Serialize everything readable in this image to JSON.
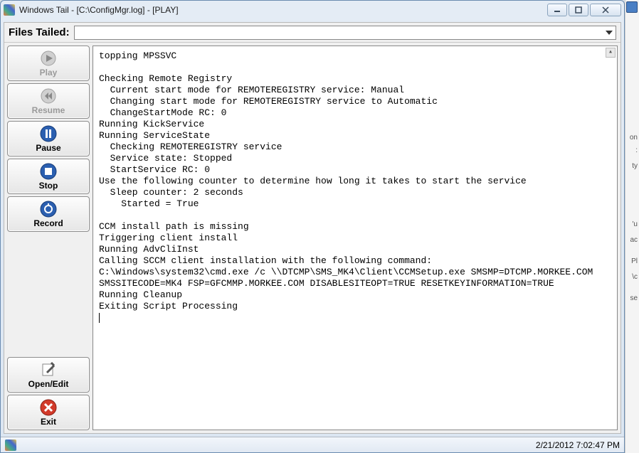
{
  "window": {
    "title": "Windows Tail - [C:\\ConfigMgr.log] - [PLAY]"
  },
  "files_tailed_label": "Files Tailed:",
  "buttons": {
    "play": "Play",
    "resume": "Resume",
    "pause": "Pause",
    "stop": "Stop",
    "record": "Record",
    "openedit": "Open/Edit",
    "exit": "Exit"
  },
  "log_text": "topping MPSSVC\n\nChecking Remote Registry\n  Current start mode for REMOTEREGISTRY service: Manual\n  Changing start mode for REMOTEREGISTRY service to Automatic\n  ChangeStartMode RC: 0\nRunning KickService\nRunning ServiceState\n  Checking REMOTEREGISTRY service\n  Service state: Stopped\n  StartService RC: 0\nUse the following counter to determine how long it takes to start the service\n  Sleep counter: 2 seconds\n    Started = True\n\nCCM install path is missing\nTriggering client install\nRunning AdvCliInst\nCalling SCCM client installation with the following command:\nC:\\Windows\\system32\\cmd.exe /c \\\\DTCMP\\SMS_MK4\\Client\\CCMSetup.exe SMSMP=DTCMP.MORKEE.COM\nSMSSITECODE=MK4 FSP=GFCMMP.MORKEE.COM DISABLESITEOPT=TRUE RESETKEYINFORMATION=TRUE\nRunning Cleanup\nExiting Script Processing",
  "status": {
    "datetime": "2/21/2012 7:02:47 PM"
  },
  "rightstrip": {
    "t1": "on",
    "t2": ":",
    "t3": "ty",
    "t4": "'u",
    "t5": "ac",
    "t6": "Pl",
    "t7": "\\c",
    "t8": "se"
  }
}
